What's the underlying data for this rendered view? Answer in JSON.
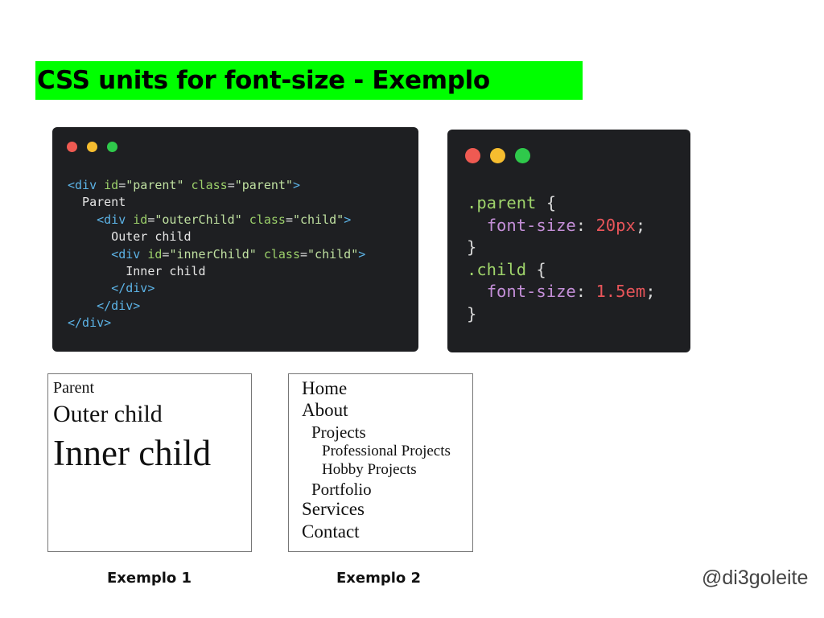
{
  "title": "CSS units for font-size - Exemplo",
  "html_window": {
    "lines": [
      "<div id=\"parent\" class=\"parent\">",
      "  Parent",
      "    <div id=\"outerChild\" class=\"child\">",
      "      Outer child",
      "      <div id=\"innerChild\" class=\"child\">",
      "        Inner child",
      "      </div>",
      "    </div>",
      "</div>"
    ]
  },
  "css_window": {
    "parent_selector": ".parent",
    "parent_property": "font-size",
    "parent_value": "20px",
    "child_selector": ".child",
    "child_property": "font-size",
    "child_value": "1.5em"
  },
  "example1": {
    "parent": "Parent",
    "outer": "Outer child",
    "inner": "Inner child",
    "caption": "Exemplo 1"
  },
  "example2": {
    "items": [
      "Home",
      "About",
      "Projects",
      "Professional Projects",
      "Hobby Projects",
      "Portfolio",
      "Services",
      "Contact"
    ],
    "caption": "Exemplo 2"
  },
  "handle": "@di3goleite",
  "colors": {
    "highlight": "#00ff00",
    "code_bg": "#1e1f22",
    "tag": "#5cb3e6",
    "attribute": "#9bcf6a",
    "selector": "#9fd46b",
    "property": "#c48fd8",
    "number": "#e8555a"
  }
}
